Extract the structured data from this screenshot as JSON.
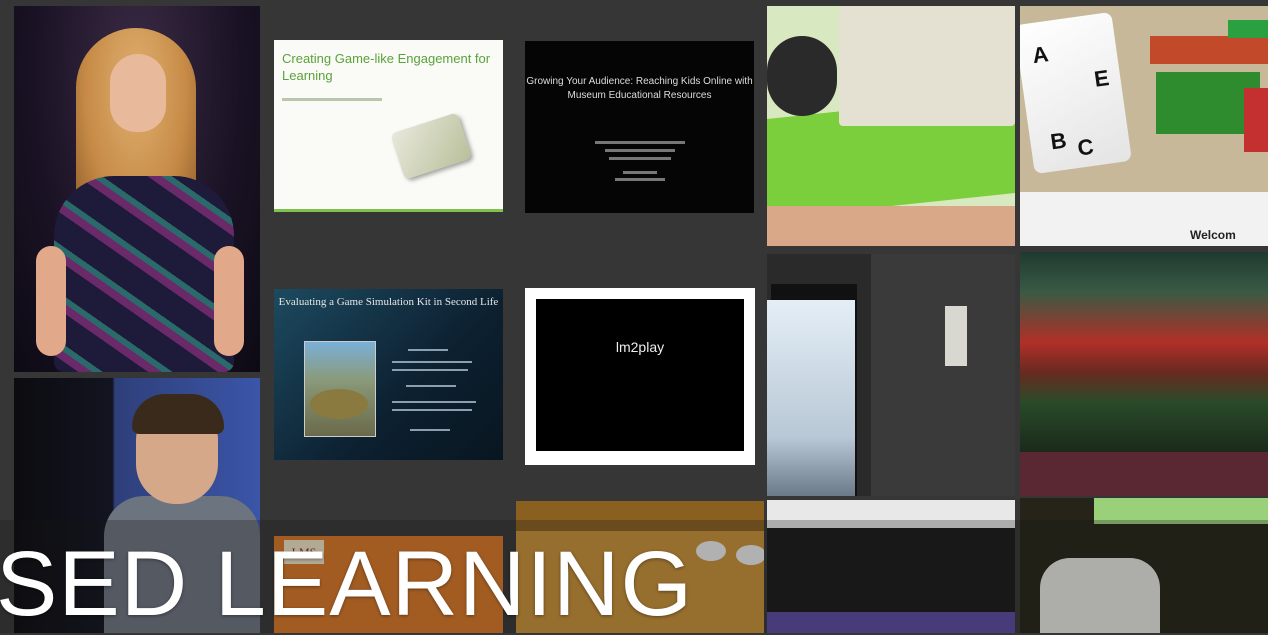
{
  "slides": {
    "game_engagement": {
      "title": "Creating Game-like Engagement for Learning"
    },
    "growing_audience": {
      "title": "Growing Your Audience: Reaching Kids Online with Museum Educational Resources"
    },
    "game_simulation": {
      "title": "Evaluating a Game Simulation Kit in Second Life"
    },
    "lm2play": {
      "title": "lm2play"
    },
    "lms": {
      "logo": "LMS"
    }
  },
  "photos": {
    "dice_letters": [
      "A",
      "B",
      "C",
      "E"
    ],
    "sign_text": "Welcom"
  },
  "caption": {
    "text": "SED LEARNING"
  },
  "colors": {
    "background": "#363636",
    "slide_title_green": "#5aa23c",
    "caption_text": "#ffffff"
  }
}
